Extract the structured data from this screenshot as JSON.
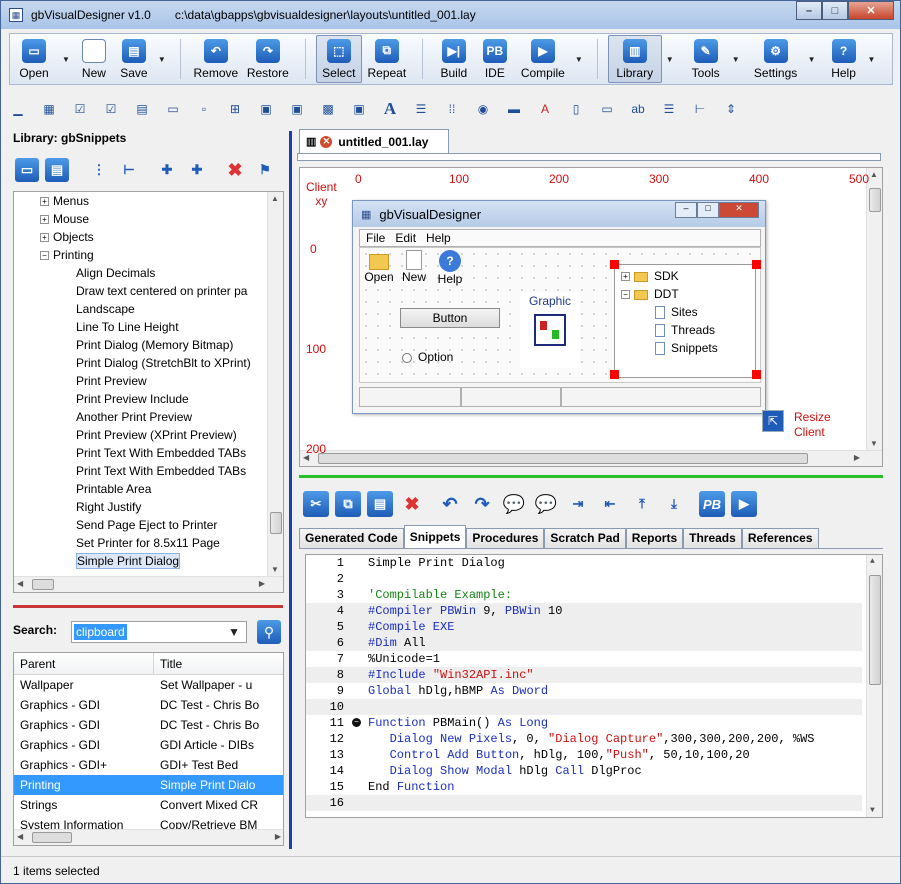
{
  "window": {
    "app_title": "gbVisualDesigner v1.0",
    "file_path": "c:\\data\\gbapps\\gbvisualdesigner\\layouts\\untitled_001.lay",
    "min": "–",
    "max": "□",
    "close": "✕"
  },
  "toolbar": [
    {
      "name": "open",
      "label": "Open",
      "icon": "folder-icon"
    },
    {
      "name": "new",
      "label": "New",
      "icon": "new-document-icon"
    },
    {
      "name": "save",
      "label": "Save",
      "icon": "floppy-icon"
    },
    {
      "name": "remove",
      "label": "Remove",
      "icon": "undo-arrow-icon"
    },
    {
      "name": "restore",
      "label": "Restore",
      "icon": "redo-arrow-icon"
    },
    {
      "name": "select",
      "label": "Select",
      "icon": "select-rect-icon"
    },
    {
      "name": "repeat",
      "label": "Repeat",
      "icon": "repeat-icon"
    },
    {
      "name": "build",
      "label": "Build",
      "icon": "build-icon"
    },
    {
      "name": "ide",
      "label": "IDE",
      "icon": "pb-icon"
    },
    {
      "name": "compile",
      "label": "Compile",
      "icon": "play-icon"
    },
    {
      "name": "library",
      "label": "Library",
      "icon": "library-icon"
    },
    {
      "name": "tools",
      "label": "Tools",
      "icon": "wrench-icon"
    },
    {
      "name": "settings",
      "label": "Settings",
      "icon": "gear-icon"
    },
    {
      "name": "help",
      "label": "Help",
      "icon": "help-icon"
    }
  ],
  "library": {
    "label": "Library:  gbSnippets"
  },
  "tree": [
    {
      "label": "Menus",
      "level": 1,
      "exp": "+"
    },
    {
      "label": "Mouse",
      "level": 1,
      "exp": "+"
    },
    {
      "label": "Objects",
      "level": 1,
      "exp": "+"
    },
    {
      "label": "Printing",
      "level": 1,
      "exp": "−"
    },
    {
      "label": "Align Decimals",
      "level": 2
    },
    {
      "label": "Draw text centered on printer pa",
      "level": 2
    },
    {
      "label": "Landscape",
      "level": 2
    },
    {
      "label": "Line To Line Height",
      "level": 2
    },
    {
      "label": "Print Dialog (Memory Bitmap)",
      "level": 2
    },
    {
      "label": "Print Dialog (StretchBlt to XPrint)",
      "level": 2
    },
    {
      "label": "Print Preview",
      "level": 2
    },
    {
      "label": "Print Preview Include",
      "level": 2
    },
    {
      "label": "Another Print Preview",
      "level": 2
    },
    {
      "label": "Print Preview (XPrint Preview)",
      "level": 2
    },
    {
      "label": "Print Text With Embedded TABs",
      "level": 2
    },
    {
      "label": "Print Text With Embedded TABs",
      "level": 2
    },
    {
      "label": "Printable Area",
      "level": 2
    },
    {
      "label": "Right Justify",
      "level": 2
    },
    {
      "label": "Send Page Eject to Printer",
      "level": 2
    },
    {
      "label": "Set Printer for 8.5x11 Page",
      "level": 2
    },
    {
      "label": "Simple Print Dialog",
      "level": 2,
      "selected": true
    }
  ],
  "search": {
    "label": "Search:",
    "value": "clipboard"
  },
  "results": {
    "columns": [
      "Parent",
      "Title"
    ],
    "rows": [
      {
        "parent": "Wallpaper",
        "title": "Set Wallpaper - u"
      },
      {
        "parent": "Graphics - GDI",
        "title": "DC Test - Chris Bo"
      },
      {
        "parent": "Graphics - GDI",
        "title": "DC Test - Chris Bo"
      },
      {
        "parent": "Graphics - GDI",
        "title": "GDI Article - DIBs"
      },
      {
        "parent": "Graphics - GDI+",
        "title": "GDI+ Test Bed"
      },
      {
        "parent": "Printing",
        "title": "Simple Print Dialo",
        "selected": true
      },
      {
        "parent": "Strings",
        "title": "Convert Mixed CR"
      },
      {
        "parent": "System Information",
        "title": "Copy/Retrieve BM"
      }
    ]
  },
  "doc_tab": {
    "label": "untitled_001.lay"
  },
  "designer": {
    "client_xy": "Client\nxy",
    "x_ticks": [
      "0",
      "100",
      "200",
      "300",
      "400",
      "500"
    ],
    "y_ticks": [
      "0",
      "100",
      "200"
    ],
    "resize_label": "Resize\nClient",
    "dialog_title": "gbVisualDesigner",
    "menu": [
      "File",
      "Edit",
      "Help"
    ],
    "icons": [
      {
        "label": "Open"
      },
      {
        "label": "New"
      },
      {
        "label": "Help"
      }
    ],
    "button_label": "Button",
    "option_label": "Option",
    "graphic_label": "Graphic",
    "tree_items": [
      {
        "label": "SDK",
        "level": 0,
        "exp": "+"
      },
      {
        "label": "DDT",
        "level": 0,
        "exp": "−"
      },
      {
        "label": "Sites",
        "level": 1
      },
      {
        "label": "Threads",
        "level": 1
      },
      {
        "label": "Snippets",
        "level": 1
      }
    ]
  },
  "code_tabs": [
    "Generated Code",
    "Snippets",
    "Procedures",
    "Scratch Pad",
    "Reports",
    "Threads",
    "References"
  ],
  "code_active_tab": "Snippets",
  "code_lines": [
    {
      "n": "1",
      "t": "Simple Print Dialog",
      "c": "plain"
    },
    {
      "n": "2",
      "t": "",
      "c": "plain"
    },
    {
      "n": "3",
      "t": "'Compilable Example:",
      "c": "cmt"
    },
    {
      "n": "4",
      "t": "#Compiler PBWin 9, PBWin 10",
      "c": "mix1",
      "shade": true
    },
    {
      "n": "5",
      "t": "#Compile EXE",
      "c": "kw",
      "shade": true
    },
    {
      "n": "6",
      "t": "#Dim All",
      "c": "mix2",
      "shade": true
    },
    {
      "n": "7",
      "t": "%Unicode=1",
      "c": "plain"
    },
    {
      "n": "8",
      "t": "#Include \"Win32API.inc\"",
      "c": "mix3",
      "shade": true
    },
    {
      "n": "9",
      "t": "Global hDlg,hBMP As Dword",
      "c": "mix4"
    },
    {
      "n": "10",
      "t": "",
      "c": "plain",
      "shade": true
    },
    {
      "n": "11",
      "t": "Function PBMain() As Long",
      "c": "kw"
    },
    {
      "n": "12",
      "t": "   Dialog New Pixels, 0, \"Dialog Capture\",300,300,200,200, %WS",
      "c": "mix5"
    },
    {
      "n": "13",
      "t": "   Control Add Button, hDlg, 100,\"Push\", 50,10,100,20",
      "c": "mix6"
    },
    {
      "n": "14",
      "t": "   Dialog Show Modal hDlg Call DlgProc",
      "c": "mix7"
    },
    {
      "n": "15",
      "t": "End Function",
      "c": "kw"
    },
    {
      "n": "16",
      "t": "",
      "c": "plain",
      "shade": true
    }
  ],
  "status": {
    "text": "1 items selected"
  }
}
